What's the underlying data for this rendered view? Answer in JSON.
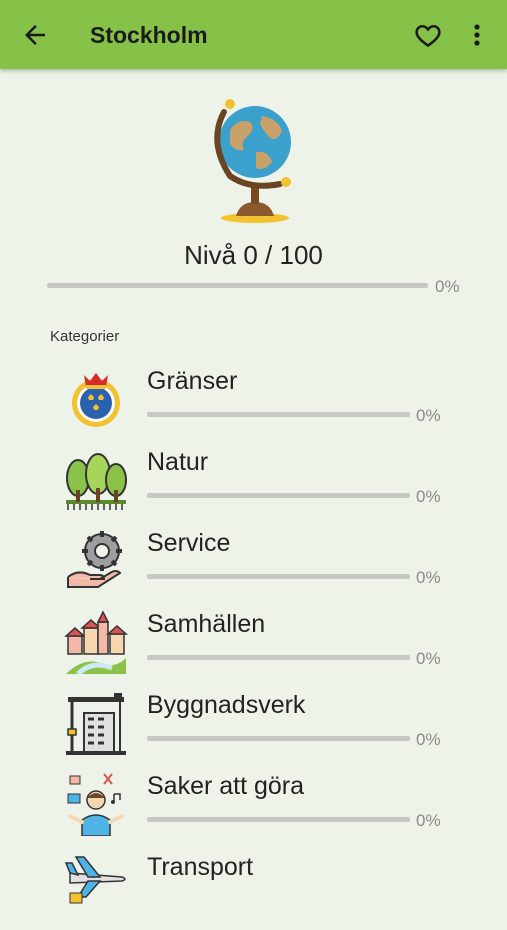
{
  "appbar": {
    "title": "Stockholm",
    "back_icon": "arrow-left-icon",
    "favorite_icon": "heart-outline-icon",
    "more_icon": "more-vertical-icon",
    "color": "#85c247"
  },
  "level": {
    "label": "Nivå 0 / 100",
    "percent_text": "0%",
    "progress": 0
  },
  "categories_title": "Kategorier",
  "categories": [
    {
      "name": "Gränser",
      "percent_text": "0%",
      "progress": 0,
      "icon": "coat-of-arms-icon"
    },
    {
      "name": "Natur",
      "percent_text": "0%",
      "progress": 0,
      "icon": "trees-icon"
    },
    {
      "name": "Service",
      "percent_text": "0%",
      "progress": 0,
      "icon": "gear-hand-icon"
    },
    {
      "name": "Samhällen",
      "percent_text": "0%",
      "progress": 0,
      "icon": "town-icon"
    },
    {
      "name": "Byggnadsverk",
      "percent_text": "0%",
      "progress": 0,
      "icon": "crane-building-icon"
    },
    {
      "name": "Saker att göra",
      "percent_text": "0%",
      "progress": 0,
      "icon": "person-activities-icon"
    },
    {
      "name": "Transport",
      "percent_text": "",
      "progress": 0,
      "icon": "airplane-icon"
    }
  ]
}
